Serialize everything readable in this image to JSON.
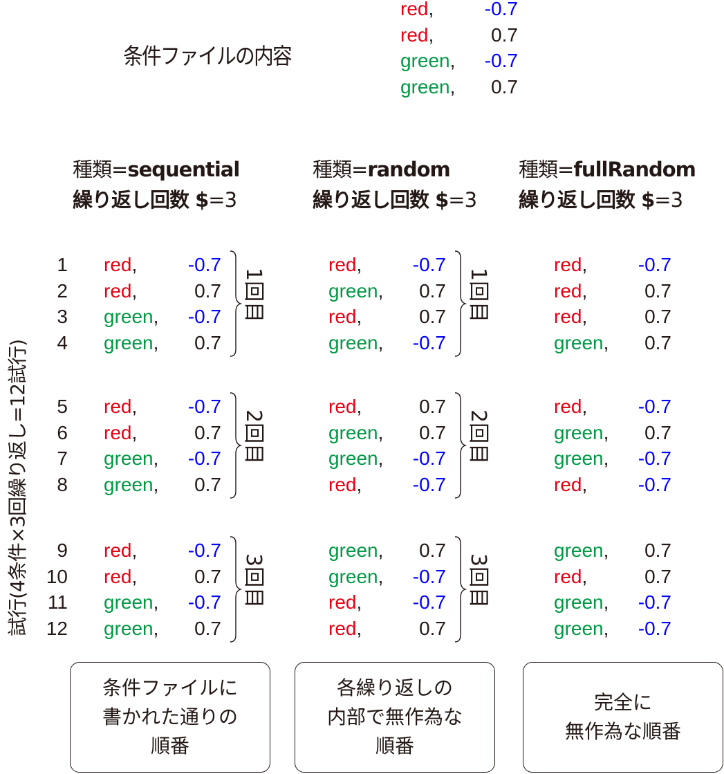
{
  "condition_file": {
    "title": "条件ファイルの内容",
    "rows": [
      {
        "color": "red",
        "value": "-0.7"
      },
      {
        "color": "red",
        "value": "0.7"
      },
      {
        "color": "green",
        "value": "-0.7"
      },
      {
        "color": "green",
        "value": "0.7"
      }
    ]
  },
  "vertical_label": "試行(4条件×3回繰り返し=12試行)",
  "trial_numbers": [
    "1",
    "2",
    "3",
    "4",
    "5",
    "6",
    "7",
    "8",
    "9",
    "10",
    "11",
    "12"
  ],
  "round_labels": [
    "1回目",
    "2回目",
    "3回目"
  ],
  "columns": [
    {
      "type_prefix": "種類=",
      "type_value": "sequential",
      "reps_label": "繰り返し回数 ",
      "reps_dollar": "$",
      "reps_value": "=3",
      "trials": [
        {
          "color": "red",
          "value": "-0.7"
        },
        {
          "color": "red",
          "value": "0.7"
        },
        {
          "color": "green",
          "value": "-0.7"
        },
        {
          "color": "green",
          "value": "0.7"
        },
        {
          "color": "red",
          "value": "-0.7"
        },
        {
          "color": "red",
          "value": "0.7"
        },
        {
          "color": "green",
          "value": "-0.7"
        },
        {
          "color": "green",
          "value": "0.7"
        },
        {
          "color": "red",
          "value": "-0.7"
        },
        {
          "color": "red",
          "value": "0.7"
        },
        {
          "color": "green",
          "value": "-0.7"
        },
        {
          "color": "green",
          "value": "0.7"
        }
      ],
      "description": [
        "条件ファイルに",
        "書かれた通りの",
        "順番"
      ]
    },
    {
      "type_prefix": "種類=",
      "type_value": "random",
      "reps_label": "繰り返し回数 ",
      "reps_dollar": "$",
      "reps_value": "=3",
      "trials": [
        {
          "color": "red",
          "value": "-0.7"
        },
        {
          "color": "green",
          "value": "0.7"
        },
        {
          "color": "red",
          "value": "0.7"
        },
        {
          "color": "green",
          "value": "-0.7"
        },
        {
          "color": "red",
          "value": "0.7"
        },
        {
          "color": "green",
          "value": "0.7"
        },
        {
          "color": "green",
          "value": "-0.7"
        },
        {
          "color": "red",
          "value": "-0.7"
        },
        {
          "color": "green",
          "value": "0.7"
        },
        {
          "color": "green",
          "value": "-0.7"
        },
        {
          "color": "red",
          "value": "-0.7"
        },
        {
          "color": "red",
          "value": "0.7"
        }
      ],
      "description": [
        "各繰り返しの",
        "内部で無作為な",
        "順番"
      ]
    },
    {
      "type_prefix": "種類=",
      "type_value": "fullRandom",
      "reps_label": "繰り返し回数 ",
      "reps_dollar": "$",
      "reps_value": "=3",
      "trials": [
        {
          "color": "red",
          "value": "-0.7"
        },
        {
          "color": "red",
          "value": "0.7"
        },
        {
          "color": "red",
          "value": "0.7"
        },
        {
          "color": "green",
          "value": "0.7"
        },
        {
          "color": "red",
          "value": "-0.7"
        },
        {
          "color": "green",
          "value": "0.7"
        },
        {
          "color": "green",
          "value": "-0.7"
        },
        {
          "color": "red",
          "value": "-0.7"
        },
        {
          "color": "green",
          "value": "0.7"
        },
        {
          "color": "red",
          "value": "0.7"
        },
        {
          "color": "green",
          "value": "-0.7"
        },
        {
          "color": "green",
          "value": "-0.7"
        }
      ],
      "description": [
        "完全に",
        "無作為な順番"
      ]
    }
  ],
  "colors": {
    "red": "#e60012",
    "green": "#009944",
    "negative_value": "#0000ff",
    "positive_value": "#231815"
  }
}
